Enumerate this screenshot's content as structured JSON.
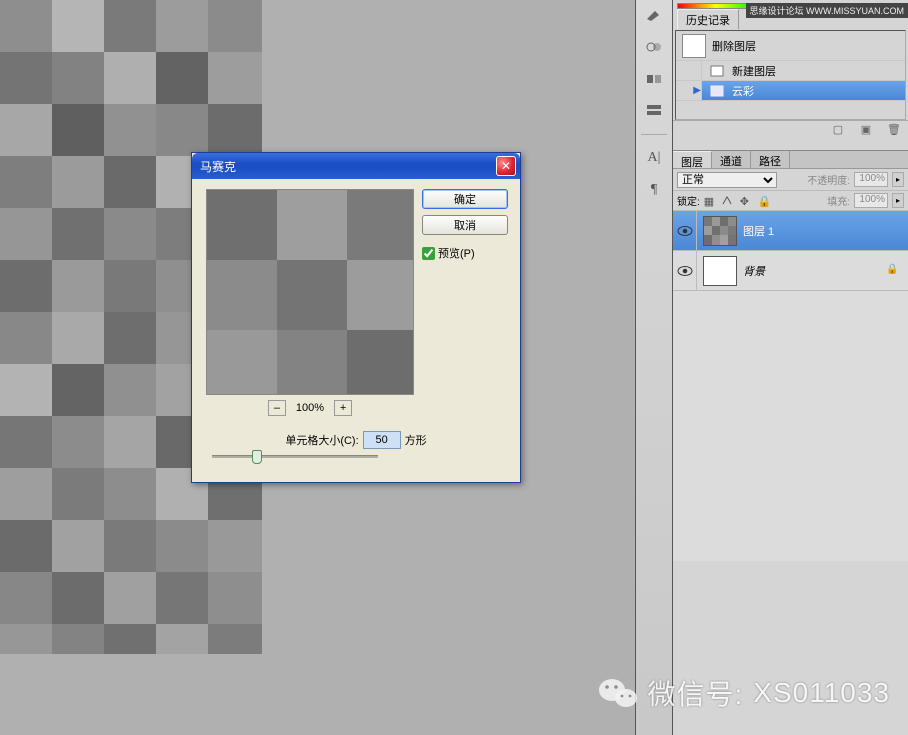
{
  "watermark_source": "思缘设计论坛  WWW.MISSYUAN.COM",
  "history": {
    "tab": "历史记录",
    "rows": [
      {
        "label": "删除图层",
        "icon": "trash"
      },
      {
        "label": "新建图层",
        "icon": "new-layer"
      },
      {
        "label": "云彩",
        "icon": "filter",
        "selected": true
      }
    ]
  },
  "layers": {
    "tabs": [
      "图层",
      "通道",
      "路径"
    ],
    "active_tab": 0,
    "blend_mode": "正常",
    "opacity_label": "不透明度:",
    "opacity_value": "100%",
    "lock_label": "锁定:",
    "fill_label": "填充:",
    "fill_value": "100%",
    "rows": [
      {
        "name": "图层 1",
        "selected": true,
        "thumb": "mosaic"
      },
      {
        "name": "背景",
        "locked": true,
        "italic": true,
        "thumb": "white"
      }
    ]
  },
  "dialog": {
    "title": "马赛克",
    "ok": "确定",
    "cancel": "取消",
    "preview": "预览(P)",
    "preview_checked": true,
    "zoom_value": "100%",
    "cell_label": "单元格大小(C):",
    "cell_value": "50",
    "cell_unit": "方形",
    "slider_pos_percent": 24
  },
  "wechat": {
    "label": "微信号:",
    "id": "XS011033"
  },
  "side_icons": [
    "tool-a",
    "tool-b",
    "tool-c",
    "tool-d",
    "A",
    "para"
  ]
}
